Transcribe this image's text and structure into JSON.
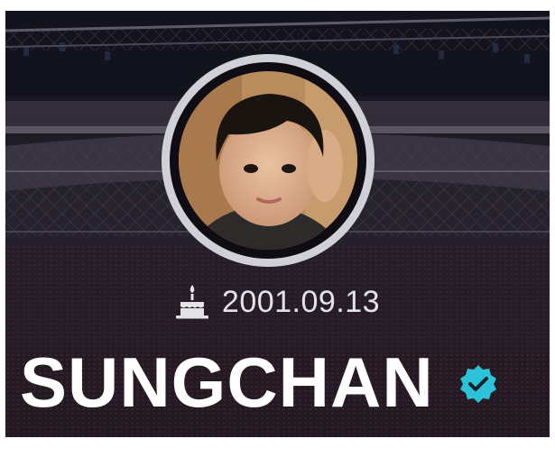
{
  "profile": {
    "birthday_icon": "birthday-cake-icon",
    "birthday": "2001.09.13",
    "name": "SUNGCHAN",
    "verified_icon": "verified-badge-icon",
    "accent_color": "#2cc3d9"
  }
}
